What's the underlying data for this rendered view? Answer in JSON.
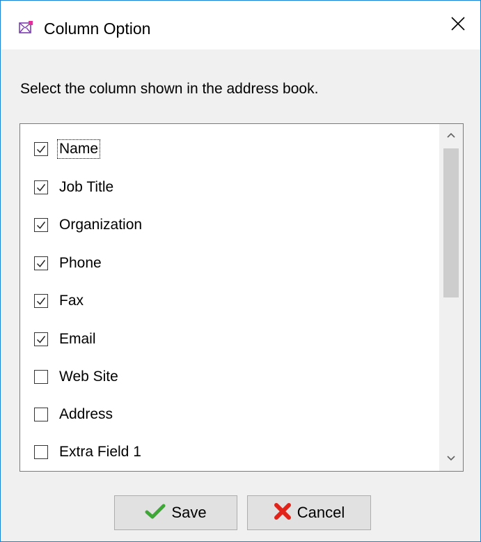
{
  "window": {
    "title": "Column Option",
    "close_glyph": "✕",
    "app_icon": "envelope-icon"
  },
  "instruction": "Select the column shown in the address book.",
  "columns": [
    {
      "label": "Name",
      "checked": true
    },
    {
      "label": "Job Title",
      "checked": true
    },
    {
      "label": "Organization",
      "checked": true
    },
    {
      "label": "Phone",
      "checked": true
    },
    {
      "label": "Fax",
      "checked": true
    },
    {
      "label": "Email",
      "checked": true
    },
    {
      "label": "Web Site",
      "checked": false
    },
    {
      "label": "Address",
      "checked": false
    },
    {
      "label": "Extra Field 1",
      "checked": false
    }
  ],
  "buttons": {
    "save_label": "Save",
    "save_icon": "green-checkmark-icon",
    "cancel_label": "Cancel",
    "cancel_icon": "red-x-icon"
  },
  "colors": {
    "window_border": "#1883d7",
    "check_green": "#3ea836",
    "cancel_red": "#e2231a"
  }
}
